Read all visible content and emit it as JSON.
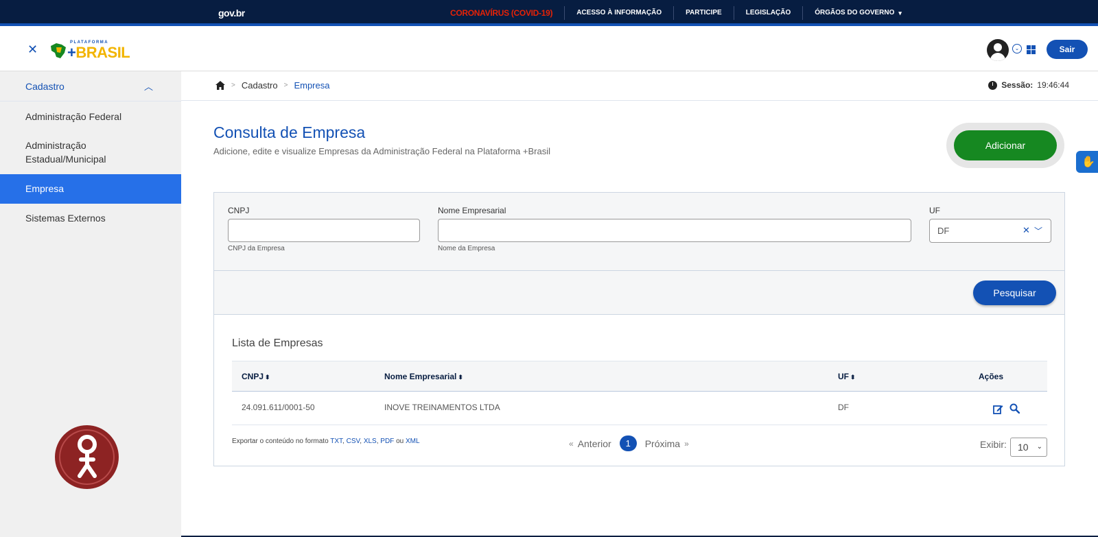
{
  "govbar": {
    "logo": "gov.br",
    "links": [
      "CORONAVÍRUS (COVID-19)",
      "ACESSO À INFORMAÇÃO",
      "PARTICIPE",
      "LEGISLAÇÃO",
      "ÓRGÃOS DO GOVERNO"
    ]
  },
  "header": {
    "logo_small": "PLATAFORMA",
    "logo_big_plus": "+",
    "logo_big": "BRASIL",
    "logout": "Sair"
  },
  "sidebar": {
    "section": "Cadastro",
    "items": [
      {
        "label": "Administração Federal"
      },
      {
        "label": "Administração"
      },
      {
        "label": "Estadual/Municipal"
      },
      {
        "label": "Empresa"
      },
      {
        "label": "Sistemas Externos"
      }
    ]
  },
  "breadcrumb": {
    "items": [
      "Cadastro",
      "Empresa"
    ],
    "separator": ">"
  },
  "session": {
    "label": "Sessão:",
    "time": "19:46:44"
  },
  "page": {
    "title": "Consulta de Empresa",
    "subtitle": "Adicione, edite e visualize Empresas da Administração Federal na Plataforma +Brasil",
    "add_label": "Adicionar"
  },
  "filters": {
    "cnpj_label": "CNPJ",
    "cnpj_value": "",
    "cnpj_hint": "CNPJ da Empresa",
    "name_label": "Nome Empresarial",
    "name_value": "",
    "name_hint": "Nome da Empresa",
    "uf_label": "UF",
    "uf_value": "DF",
    "search_label": "Pesquisar"
  },
  "list": {
    "title": "Lista de Empresas",
    "columns": [
      "CNPJ",
      "Nome Empresarial",
      "UF",
      "Ações"
    ],
    "rows": [
      {
        "cnpj": "24.091.611/0001-50",
        "name": "INOVE TREINAMENTOS LTDA",
        "uf": "DF"
      }
    ]
  },
  "export": {
    "prefix": "Exportar o conteúdo no formato",
    "formats": [
      "TXT",
      "CSV",
      "XLS",
      "PDF"
    ],
    "or": "ou",
    "last": "XML"
  },
  "pagination": {
    "prev": "Anterior",
    "next": "Próxima",
    "current": "1",
    "show_label": "Exibir:",
    "page_size": "10"
  },
  "colors": {
    "primary": "#1351b4",
    "govbar": "#071d41",
    "success": "#168821",
    "active_sidebar": "#2670e8",
    "covid": "#e52207"
  }
}
